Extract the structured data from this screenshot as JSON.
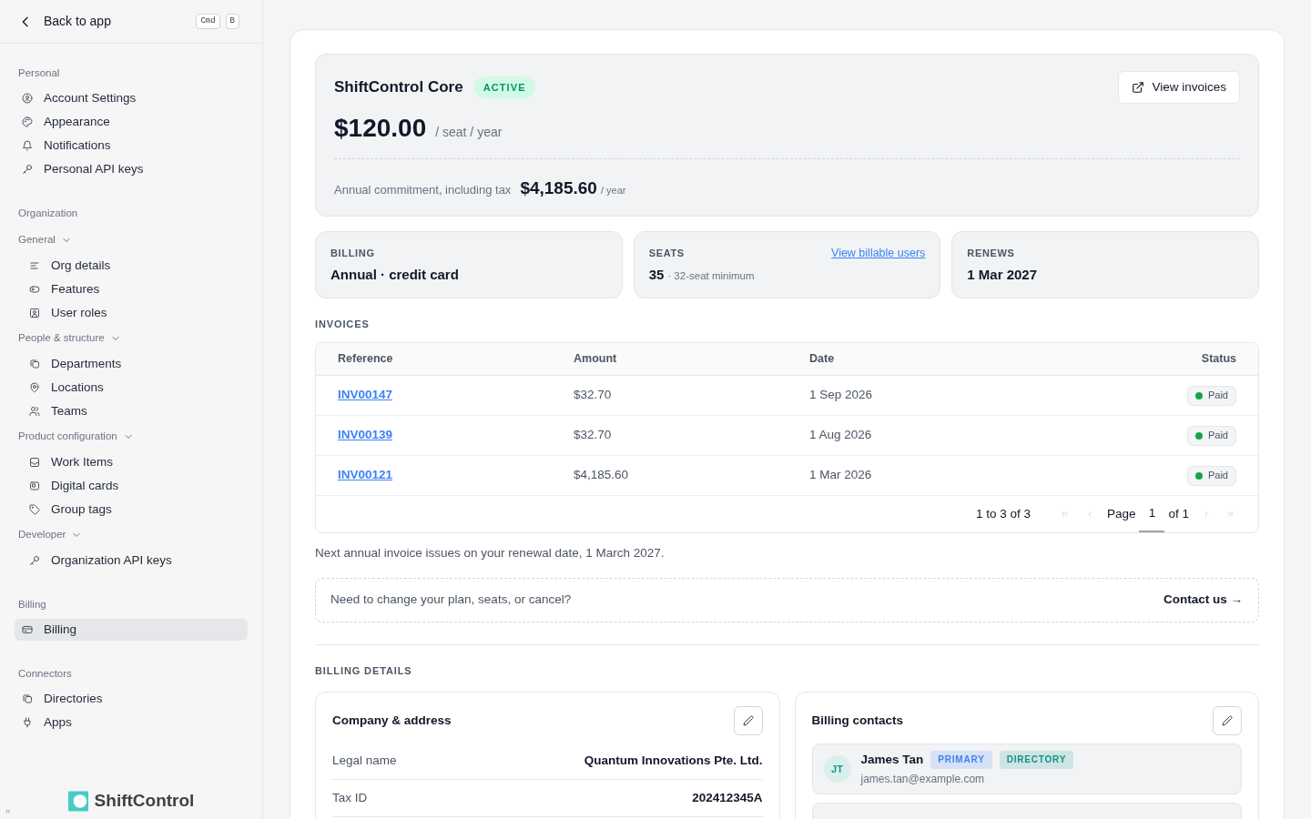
{
  "sidebar": {
    "back_label": "Back to app",
    "shortcut_keys": [
      "Cmd",
      "B"
    ],
    "sections": [
      {
        "title": "Personal",
        "items": [
          {
            "label": "Account Settings",
            "selected": false
          },
          {
            "label": "Appearance",
            "selected": false
          },
          {
            "label": "Notifications",
            "selected": false
          },
          {
            "label": "Personal API keys",
            "selected": false
          }
        ]
      },
      {
        "title": "Organization",
        "groups": [
          {
            "label": "General",
            "expanded": true,
            "children": [
              {
                "label": "Org details",
                "selected": false
              },
              {
                "label": "Features",
                "selected": false
              },
              {
                "label": "User roles",
                "selected": false
              }
            ]
          },
          {
            "label": "People & structure",
            "expanded": true,
            "children": [
              {
                "label": "Departments",
                "selected": false
              },
              {
                "label": "Locations",
                "selected": false
              },
              {
                "label": "Teams",
                "selected": false
              }
            ]
          },
          {
            "label": "Product configuration",
            "expanded": true,
            "children": [
              {
                "label": "Work Items",
                "selected": false
              },
              {
                "label": "Digital cards",
                "selected": false
              },
              {
                "label": "Group tags",
                "selected": false
              }
            ]
          },
          {
            "label": "Developer",
            "expanded": true,
            "children": [
              {
                "label": "Organization API keys",
                "selected": false
              }
            ]
          }
        ]
      },
      {
        "title": "Billing",
        "items": [
          {
            "label": "Billing",
            "selected": true
          }
        ]
      },
      {
        "title": "Connectors",
        "items": [
          {
            "label": "Directories",
            "selected": false
          },
          {
            "label": "Apps",
            "selected": false
          }
        ]
      }
    ],
    "logo_text": "ShiftControl",
    "corner_glyph": "π"
  },
  "plan": {
    "name": "ShiftControl Core",
    "status": "ACTIVE",
    "view_invoices": "View invoices",
    "price": "$120.00",
    "price_unit": "/ seat / year",
    "commitment_label": "Annual commitment, including tax",
    "commitment_amount": "$4,185.60",
    "commitment_unit": "/ year"
  },
  "stats": [
    {
      "label": "BILLING",
      "value": "Annual · credit card"
    },
    {
      "label": "SEATS",
      "value": "35",
      "note": "· 32-seat minimum",
      "link": "View billable users"
    },
    {
      "label": "RENEWS",
      "value": "1 Mar 2027"
    }
  ],
  "invoices": {
    "title": "INVOICES",
    "columns": [
      "Reference",
      "Amount",
      "Date",
      "Status"
    ],
    "rows": [
      {
        "reference": "INV00147",
        "amount": "$32.70",
        "date": "1 Sep 2026",
        "status": "Paid"
      },
      {
        "reference": "INV00139",
        "amount": "$32.70",
        "date": "1 Aug 2026",
        "status": "Paid"
      },
      {
        "reference": "INV00121",
        "amount": "$4,185.60",
        "date": "1 Mar 2026",
        "status": "Paid"
      }
    ],
    "pagination": {
      "range": "1 to 3 of 3",
      "page_label": "Page",
      "page": "1",
      "page_total": "of 1",
      "nav": [
        {
          "disabled": true
        },
        {
          "disabled": true
        },
        {
          "disabled": true
        },
        {
          "disabled": true
        }
      ]
    }
  },
  "renewal_note": "Next annual invoice issues on your renewal date, 1 March 2027.",
  "contact_banner": {
    "text": "Need to change your plan, seats, or cancel?",
    "link": "Contact us →"
  },
  "billing_details": {
    "title": "BILLING DETAILS",
    "company": {
      "title": "Company & address",
      "fields": [
        {
          "label": "Legal name",
          "value": "Quantum Innovations Pte. Ltd."
        },
        {
          "label": "Tax ID",
          "value": "202412345A"
        }
      ]
    },
    "contacts": {
      "title": "Billing contacts",
      "people": [
        {
          "initials": "JT",
          "name": "James Tan",
          "email": "james.tan@example.com",
          "tags": [
            {
              "label": "PRIMARY",
              "color": "#3b82f6"
            },
            {
              "label": "DIRECTORY",
              "color": "#0d9488"
            }
          ]
        }
      ]
    }
  }
}
